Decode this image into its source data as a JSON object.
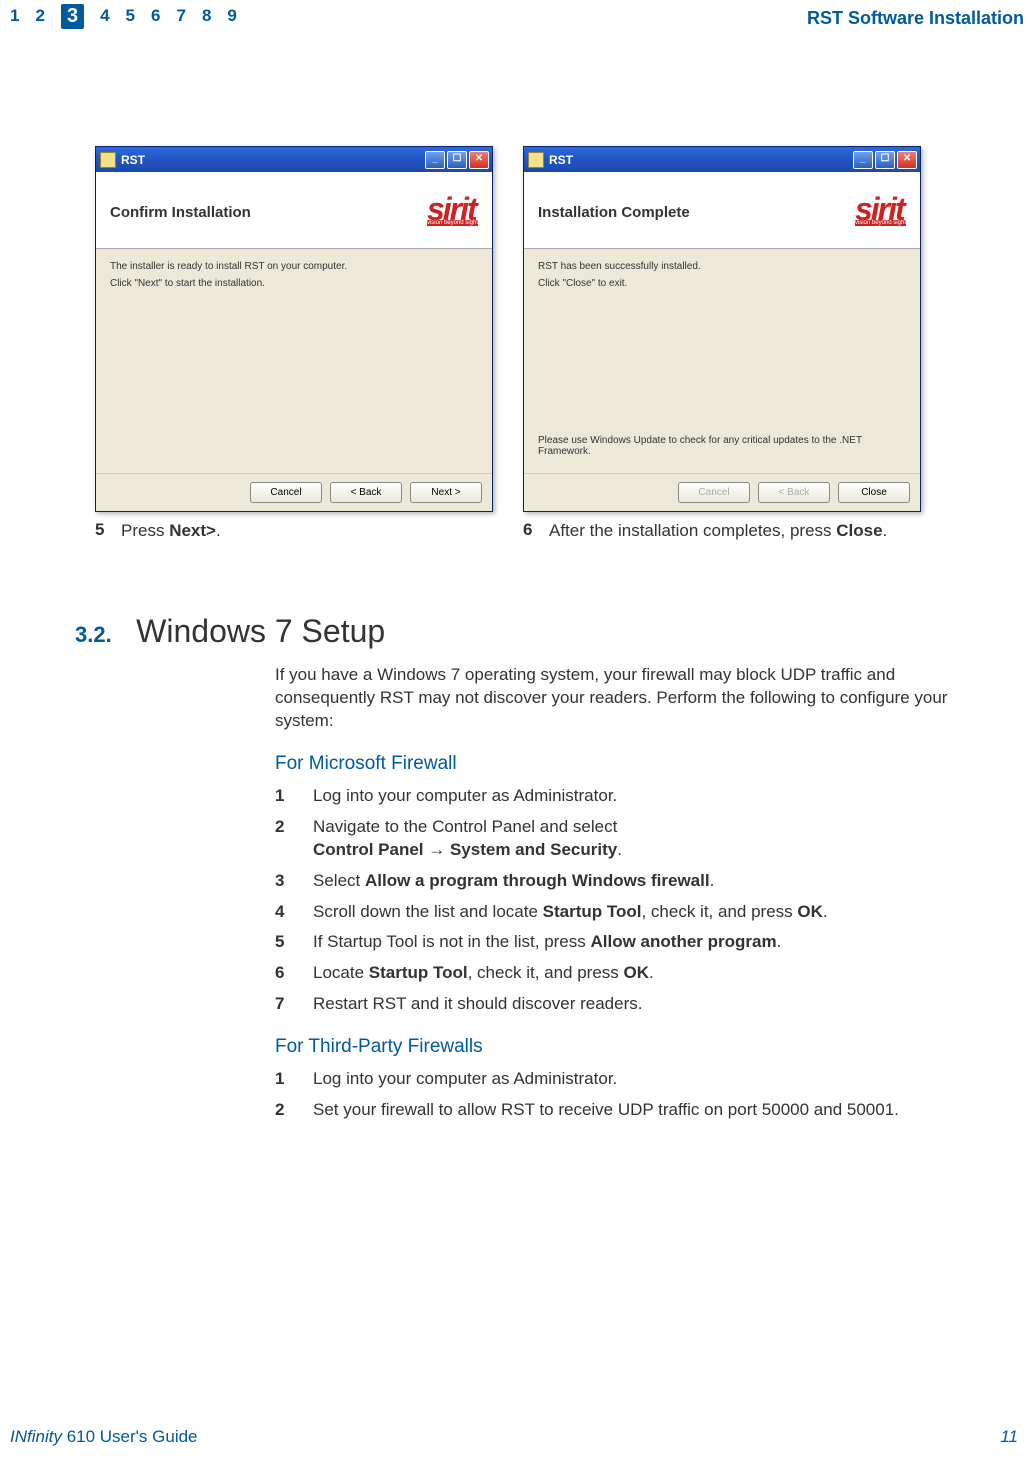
{
  "header": {
    "chapters": [
      "1",
      "2",
      "3",
      "4",
      "5",
      "6",
      "7",
      "8",
      "9"
    ],
    "current_index": 2,
    "title": "RST Software Installation"
  },
  "dialog1": {
    "window_title": "RST",
    "head": "Confirm Installation",
    "line1": "The installer is ready to install RST on your computer.",
    "line2": "Click \"Next\" to start the installation.",
    "btn_cancel": "Cancel",
    "btn_back": "< Back",
    "btn_next": "Next >",
    "caption_num": "5",
    "caption_parts": [
      "Press ",
      "Next>",
      "."
    ]
  },
  "dialog2": {
    "window_title": "RST",
    "head": "Installation Complete",
    "line1": "RST has been successfully installed.",
    "line2": "Click \"Close\" to exit.",
    "note": "Please use Windows Update to check for any critical updates to the .NET Framework.",
    "btn_cancel": "Cancel",
    "btn_back": "< Back",
    "btn_close": "Close",
    "caption_num": "6",
    "caption_parts": [
      "After the installation completes, press ",
      "Close",
      "."
    ]
  },
  "section": {
    "num": "3.2.",
    "title": "Windows 7 Setup",
    "intro": "If you have a Windows 7 operating system, your firewall may block UDP traffic and consequently RST may not discover your readers. Perform the following to configure your system:",
    "sub1": "For Microsoft Firewall",
    "list1": [
      {
        "n": "1",
        "parts": [
          "Log into your computer as Administrator."
        ]
      },
      {
        "n": "2",
        "parts": [
          "Navigate to the Control Panel and select",
          "<br>",
          "<b>Control Panel → System and Security</b>",
          "."
        ]
      },
      {
        "n": "3",
        "parts": [
          "Select ",
          "<b>Allow a program through Windows firewall</b>",
          "."
        ]
      },
      {
        "n": "4",
        "parts": [
          "Scroll down the list and locate ",
          "<b>Startup Tool</b>",
          ", check it, and press ",
          "<b>OK</b>",
          "."
        ]
      },
      {
        "n": "5",
        "parts": [
          "If Startup Tool is not in the list, press ",
          "<b>Allow another program</b>",
          "."
        ]
      },
      {
        "n": "6",
        "parts": [
          "Locate ",
          "<b>Startup Tool</b>",
          ", check it, and press ",
          "<b>OK</b>",
          "."
        ]
      },
      {
        "n": "7",
        "parts": [
          "Restart RST and it should discover readers."
        ]
      }
    ],
    "sub2": "For Third-Party Firewalls",
    "list2": [
      {
        "n": "1",
        "parts": [
          "Log into your computer as Administrator."
        ]
      },
      {
        "n": "2",
        "parts": [
          "Set your firewall to allow RST to receive UDP traffic on port 50000 and 50001."
        ]
      }
    ]
  },
  "footer": {
    "left_parts": [
      "IN",
      "finity",
      " 610 User's Guide"
    ],
    "right": "11"
  },
  "logo": {
    "text": "sirit",
    "tag": "vision beyond sight"
  }
}
